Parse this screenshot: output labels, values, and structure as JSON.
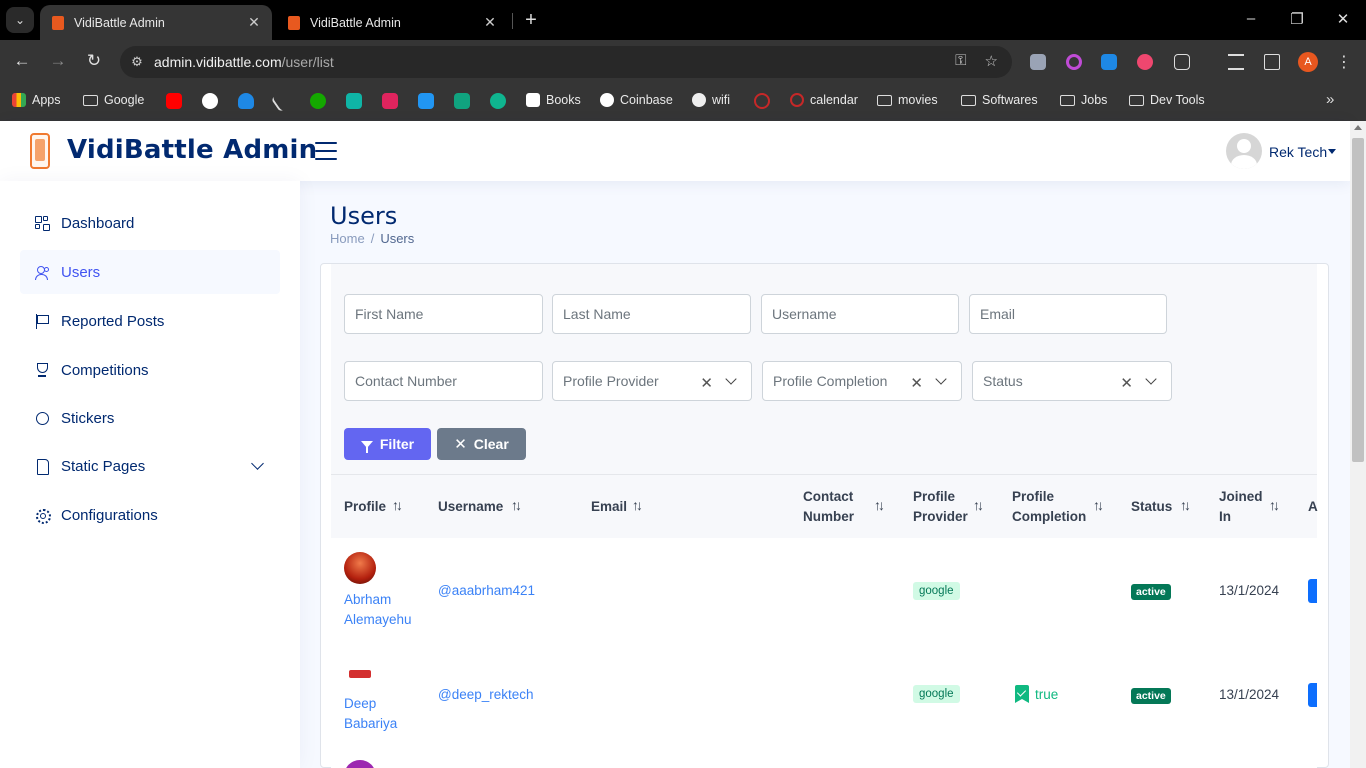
{
  "browser": {
    "tabs": [
      {
        "title": "VidiBattle Admin",
        "active": true
      },
      {
        "title": "VidiBattle Admin",
        "active": false
      }
    ],
    "url_host": "admin.vidibattle.com",
    "url_path": "/user/list",
    "profile_initial": "A",
    "bookmarks": [
      "Apps",
      "Google",
      "Books",
      "Coinbase",
      "wifi",
      "calendar",
      "movies",
      "Softwares",
      "Jobs",
      "Dev Tools"
    ]
  },
  "header": {
    "brand": "VidiBattle Admin",
    "user_name": "Rek Tech"
  },
  "sidebar": {
    "items": [
      {
        "label": "Dashboard",
        "icon": "grid-icon"
      },
      {
        "label": "Users",
        "icon": "people-icon",
        "active": true
      },
      {
        "label": "Reported Posts",
        "icon": "flag-icon"
      },
      {
        "label": "Competitions",
        "icon": "trophy-icon"
      },
      {
        "label": "Stickers",
        "icon": "circle-icon"
      },
      {
        "label": "Static Pages",
        "icon": "file-icon",
        "expandable": true
      },
      {
        "label": "Configurations",
        "icon": "gear-icon"
      }
    ]
  },
  "main": {
    "title": "Users",
    "breadcrumb": {
      "home": "Home",
      "sep": "/",
      "current": "Users"
    },
    "filters": {
      "first_name": "First Name",
      "last_name": "Last Name",
      "username": "Username",
      "email": "Email",
      "contact_number": "Contact Number",
      "profile_provider": "Profile Provider",
      "profile_completion": "Profile Completion",
      "status": "Status",
      "filter_btn": "Filter",
      "clear_btn": "Clear"
    },
    "table": {
      "headers": {
        "profile": "Profile",
        "username": "Username",
        "email": "Email",
        "contact_1": "Contact",
        "contact_2": "Number",
        "provider_1": "Profile",
        "provider_2": "Provider",
        "completion_1": "Profile",
        "completion_2": "Completion",
        "status": "Status",
        "joined_1": "Joined",
        "joined_2": "In",
        "action": "A"
      },
      "rows": [
        {
          "first": "Abrham",
          "last": "Alemayehu",
          "username": "@aaabrham421",
          "provider": "google",
          "completion": "",
          "status": "active",
          "joined": "13/1/2024"
        },
        {
          "first": "Deep",
          "last": "Babariya",
          "username": "@deep_rektech",
          "provider": "google",
          "completion": "true",
          "status": "active",
          "joined": "13/1/2024"
        }
      ]
    }
  }
}
